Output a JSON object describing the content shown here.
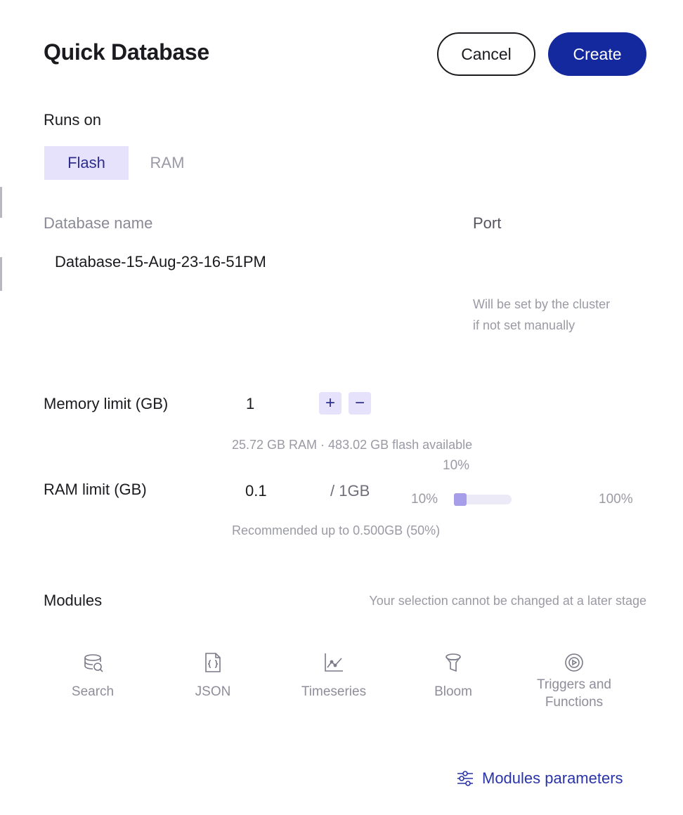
{
  "header": {
    "title": "Quick Database",
    "cancel_label": "Cancel",
    "create_label": "Create"
  },
  "runs_on": {
    "label": "Runs on",
    "options": [
      "Flash",
      "RAM"
    ],
    "selected": "Flash"
  },
  "database_name": {
    "label": "Database name",
    "value": "Database-15-Aug-23-16-51PM"
  },
  "port": {
    "label": "Port",
    "hint_line1": "Will be set by the cluster",
    "hint_line2": "if not set manually"
  },
  "memory_limit": {
    "label": "Memory limit (GB)",
    "value": "1",
    "plus": "+",
    "minus": "−",
    "available": "25.72 GB RAM · 483.02 GB flash available"
  },
  "ram_limit": {
    "label": "RAM limit (GB)",
    "value": "0.1",
    "of_total": "/ 1GB",
    "slider_current": "10%",
    "slider_min": "10%",
    "slider_max": "100%",
    "slider_fraction": 0.1,
    "recommendation": "Recommended up to 0.500GB (50%)"
  },
  "modules": {
    "label": "Modules",
    "note": "Your selection cannot be changed at a later stage",
    "items": [
      {
        "label": "Search",
        "icon": "search-module-icon"
      },
      {
        "label": "JSON",
        "icon": "json-module-icon"
      },
      {
        "label": "Timeseries",
        "icon": "timeseries-module-icon"
      },
      {
        "label": "Bloom",
        "icon": "bloom-module-icon"
      },
      {
        "label_line1": "Triggers and",
        "label_line2": "Functions",
        "icon": "triggers-functions-module-icon"
      }
    ]
  },
  "modules_parameters": {
    "label": "Modules parameters",
    "icon": "sliders-icon"
  },
  "colors": {
    "primary": "#14299d",
    "selected_bg": "#e6e2fb",
    "link": "#2a33a8",
    "muted": "#8a8a96"
  }
}
